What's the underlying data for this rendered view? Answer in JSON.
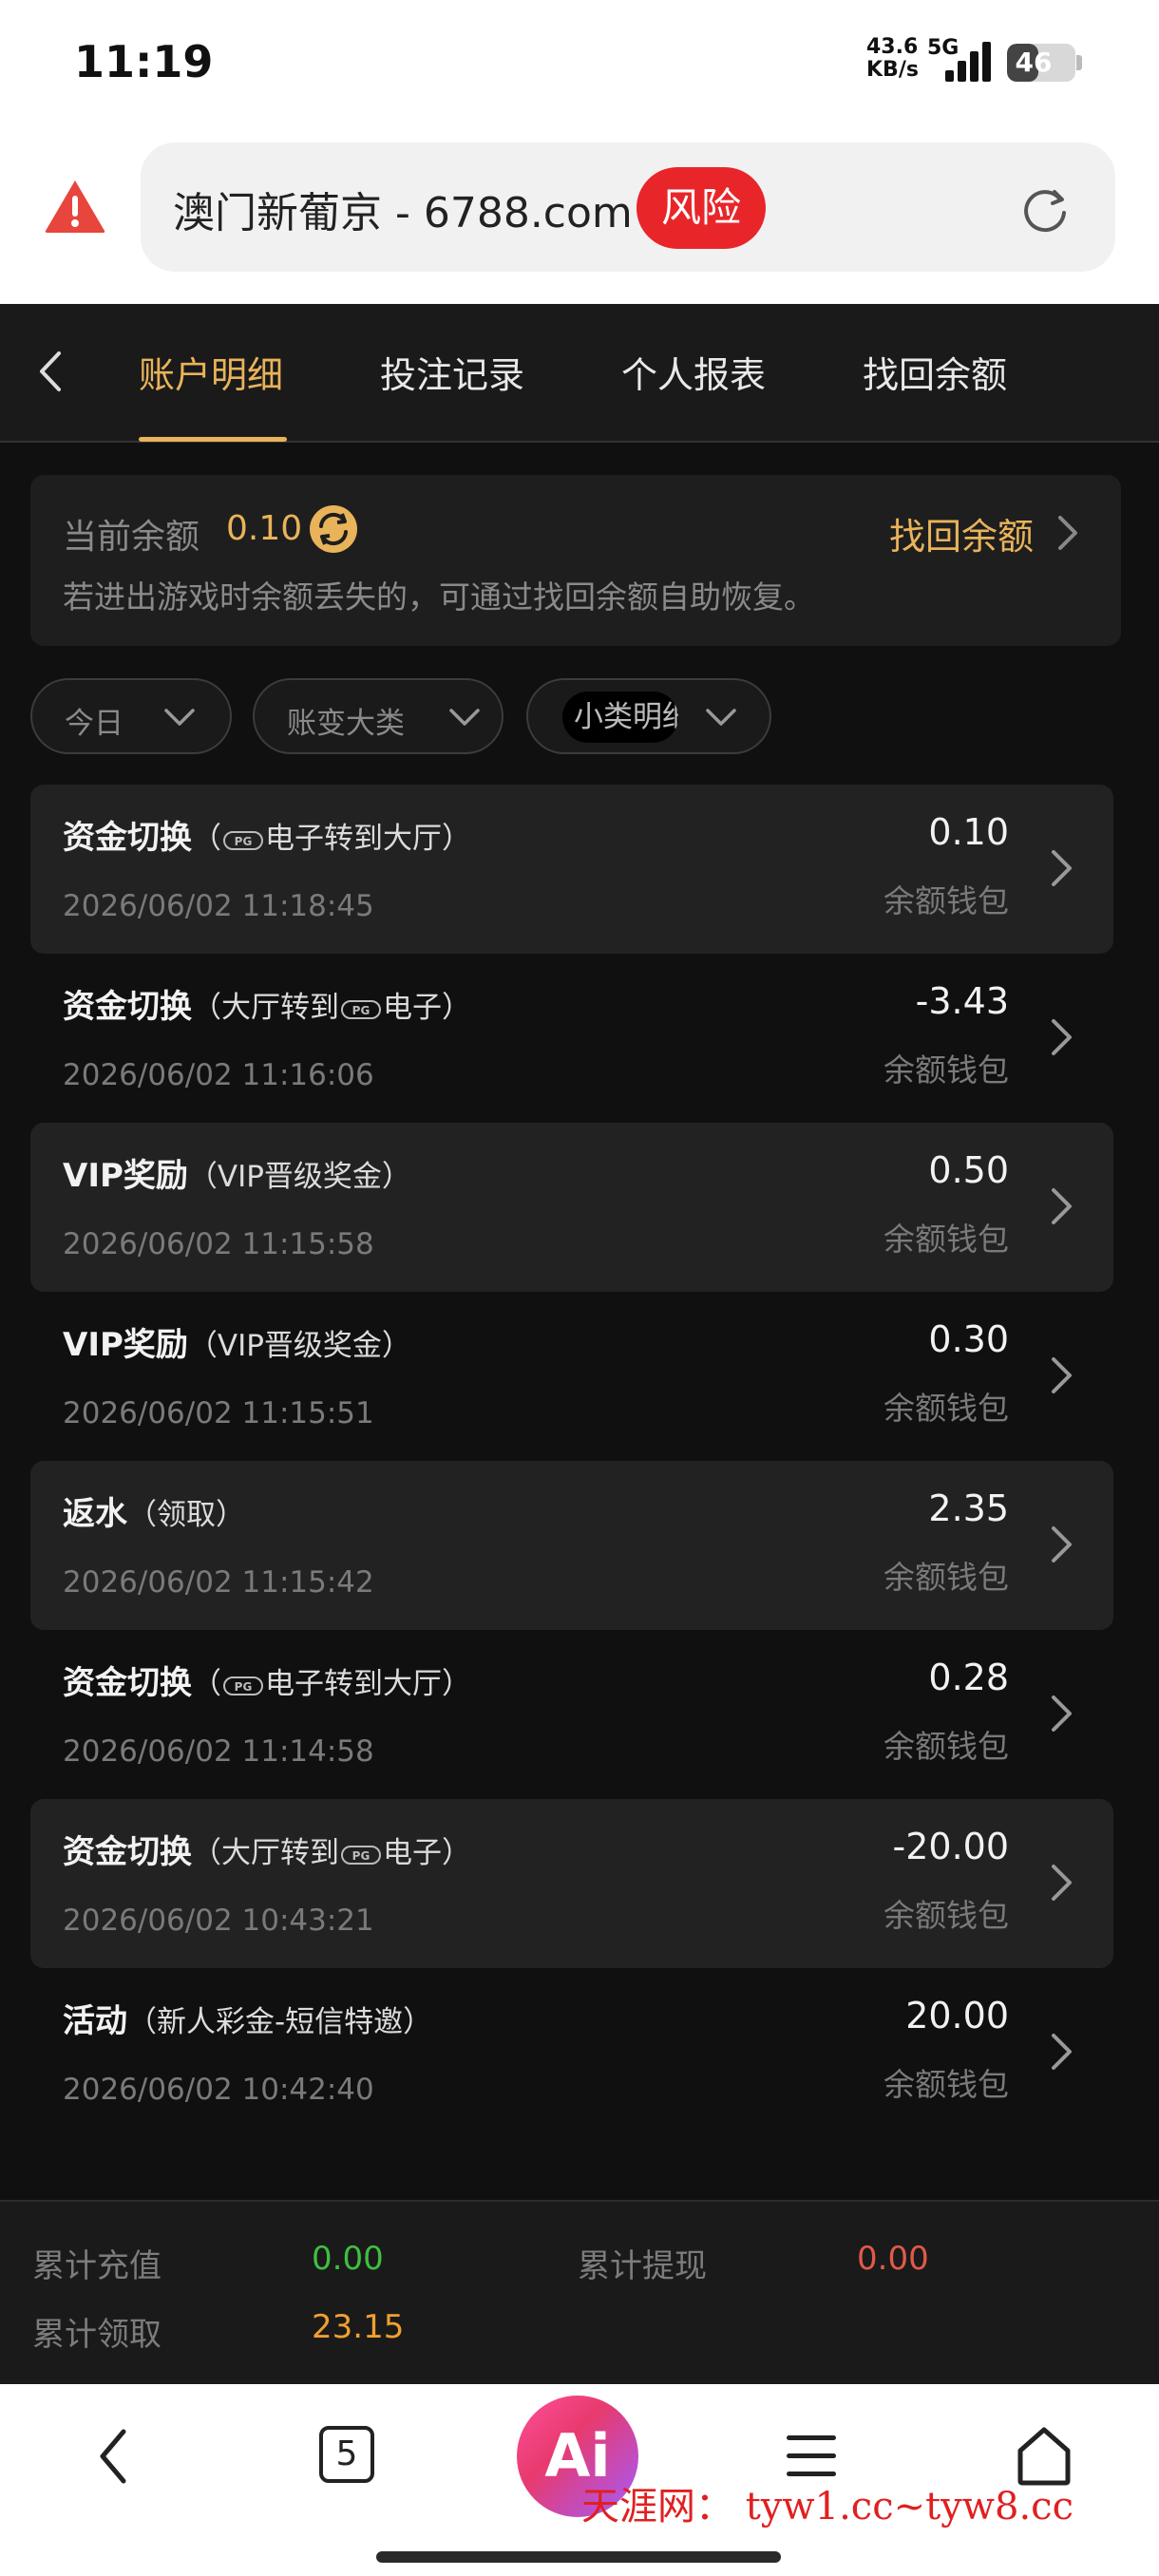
{
  "status_bar": {
    "time": "11:19",
    "net_speed_top": "43.6",
    "net_speed_bottom": "KB/s",
    "network": "5G",
    "battery": "46"
  },
  "url_bar": {
    "site_text": "澳门新葡京 - 6788.com",
    "risk_badge": "风险"
  },
  "tabs": [
    {
      "label": "账户明细",
      "active": true
    },
    {
      "label": "投注记录",
      "active": false
    },
    {
      "label": "个人报表",
      "active": false
    },
    {
      "label": "找回余额",
      "active": false
    }
  ],
  "balance": {
    "label": "当前余额",
    "value": "0.10",
    "recover_link": "找回余额",
    "note": "若进出游戏时余额丢失的，可通过找回余额自助恢复。"
  },
  "filters": [
    {
      "label": "今日"
    },
    {
      "label": "账变大类"
    },
    {
      "label": "小类明细"
    }
  ],
  "transactions": [
    {
      "title": "资金切换",
      "detail_pre": "（",
      "detail_logo": "PG",
      "detail_post": "电子转到大厅）",
      "time": "2026/06/02 11:18:45",
      "amount": "0.10",
      "wallet": "余额钱包"
    },
    {
      "title": "资金切换",
      "detail_pre": "（大厅转到",
      "detail_logo": "PG",
      "detail_post": "电子）",
      "time": "2026/06/02 11:16:06",
      "amount": "-3.43",
      "wallet": "余额钱包"
    },
    {
      "title": "VIP奖励",
      "detail_pre": "（VIP晋级奖金）",
      "detail_logo": "",
      "detail_post": "",
      "time": "2026/06/02 11:15:58",
      "amount": "0.50",
      "wallet": "余额钱包"
    },
    {
      "title": "VIP奖励",
      "detail_pre": "（VIP晋级奖金）",
      "detail_logo": "",
      "detail_post": "",
      "time": "2026/06/02 11:15:51",
      "amount": "0.30",
      "wallet": "余额钱包"
    },
    {
      "title": "返水",
      "detail_pre": "（领取）",
      "detail_logo": "",
      "detail_post": "",
      "time": "2026/06/02 11:15:42",
      "amount": "2.35",
      "wallet": "余额钱包"
    },
    {
      "title": "资金切换",
      "detail_pre": "（",
      "detail_logo": "PG",
      "detail_post": "电子转到大厅）",
      "time": "2026/06/02 11:14:58",
      "amount": "0.28",
      "wallet": "余额钱包"
    },
    {
      "title": "资金切换",
      "detail_pre": "（大厅转到",
      "detail_logo": "PG",
      "detail_post": "电子）",
      "time": "2026/06/02 10:43:21",
      "amount": "-20.00",
      "wallet": "余额钱包"
    },
    {
      "title": "活动",
      "detail_pre": "（新人彩金-短信特邀）",
      "detail_logo": "",
      "detail_post": "",
      "time": "2026/06/02 10:42:40",
      "amount": "20.00",
      "wallet": "余额钱包"
    }
  ],
  "summary": {
    "deposit_label": "累计充值",
    "deposit_value": "0.00",
    "withdraw_label": "累计提现",
    "withdraw_value": "0.00",
    "claimed_label": "累计领取",
    "claimed_value": "23.15"
  },
  "browser_bar": {
    "tab_count": "5",
    "ai_label": "Ai",
    "watermark": "天涯网： tyw1.cc~tyw8.cc"
  },
  "colors": {
    "accent_gold": "#e9b35a",
    "risk_red": "#e8262a",
    "positive_green": "#3fbf3f",
    "negative_red": "#e05a4a",
    "claimed_orange": "#f0a030"
  }
}
